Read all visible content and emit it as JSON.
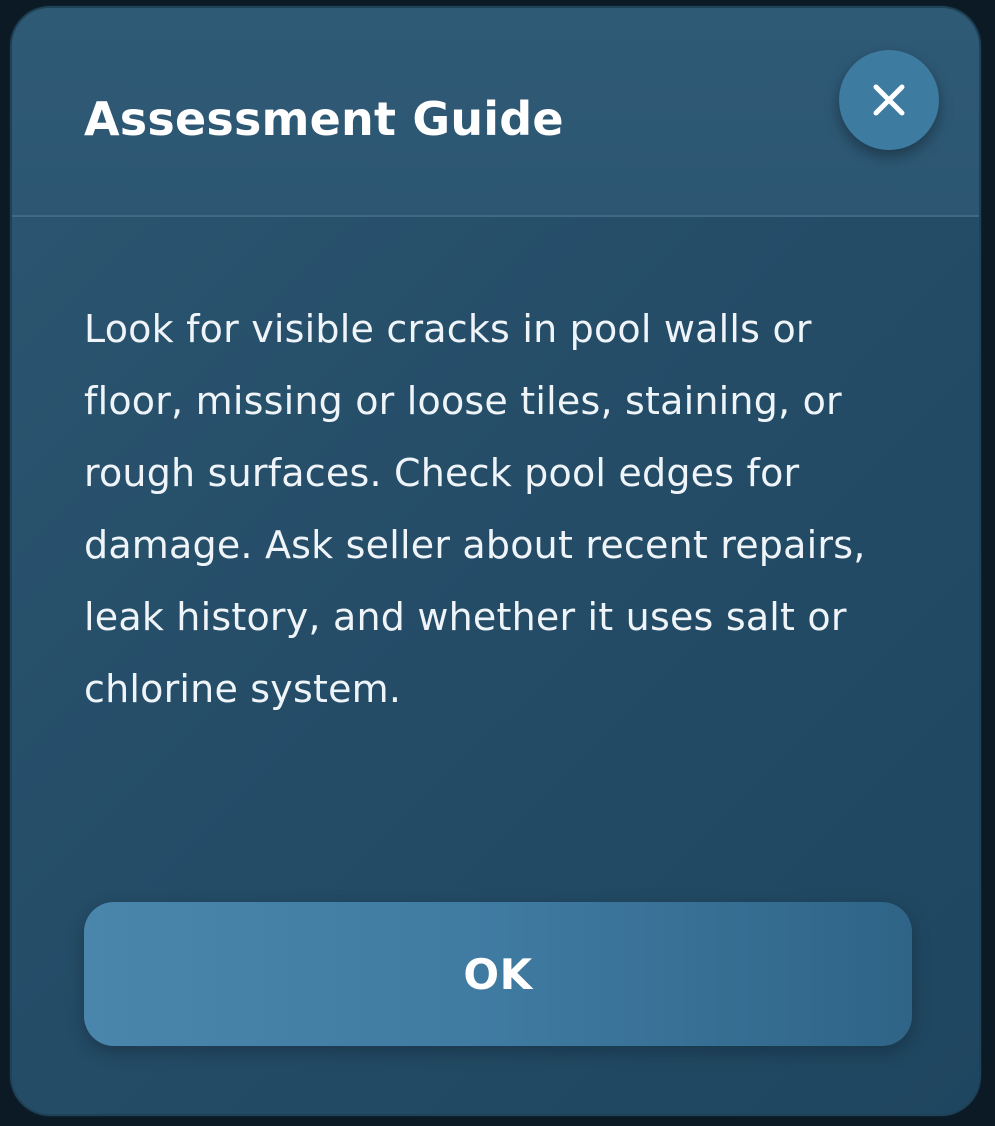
{
  "dialog": {
    "title": "Assessment Guide",
    "close_icon": "close-icon",
    "body": "Look for visible cracks in pool walls or floor, missing or loose tiles, staining, or rough surfaces. Check pool edges for damage. Ask seller about recent repairs, leak history, and whether it uses salt or chlorine system.",
    "ok_label": "OK"
  },
  "colors": {
    "background": "#0b1a24",
    "dialog": "#2a536f",
    "close_button": "#3e7ba0",
    "ok_button": "#4080a6",
    "text": "#ffffff"
  }
}
